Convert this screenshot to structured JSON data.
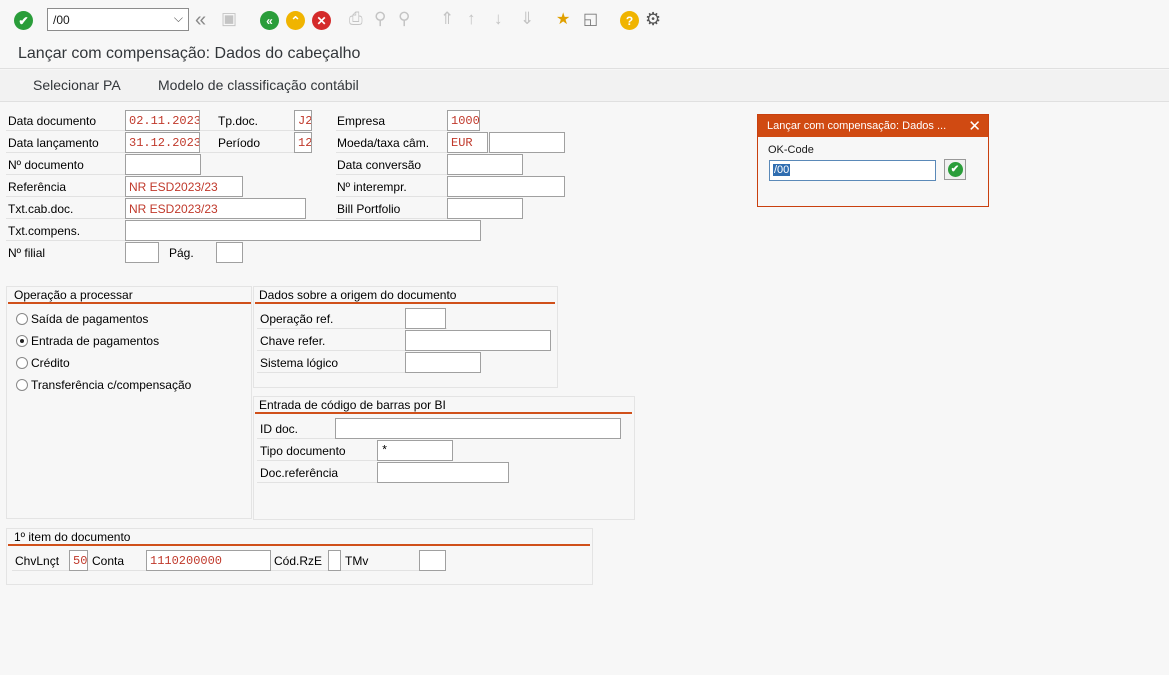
{
  "toolbar": {
    "command_value": "/00",
    "icons": [
      "enter-icon",
      "back-double-icon",
      "save-icon",
      "back-icon",
      "exit-icon",
      "cancel-icon",
      "print-icon",
      "find-icon",
      "find-next-icon",
      "first-page-icon",
      "previous-page-icon",
      "next-page-icon",
      "last-page-icon",
      "new-session-icon",
      "shortcut-icon",
      "help-icon",
      "settings-icon"
    ]
  },
  "header": {
    "title": "Lançar com compensação: Dados do cabeçalho"
  },
  "menu": {
    "item1": "Selecionar PA",
    "item2": "Modelo de classificação contábil"
  },
  "form": {
    "data_documento_label": "Data documento",
    "data_documento": "02.11.2023",
    "tp_doc_label": "Tp.doc.",
    "tp_doc": "J2",
    "empresa_label": "Empresa",
    "empresa": "1000",
    "data_lancamento_label": "Data lançamento",
    "data_lancamento": "31.12.2023",
    "periodo_label": "Período",
    "periodo": "12",
    "moeda_label": "Moeda/taxa câm.",
    "moeda": "EUR",
    "taxa": "",
    "no_documento_label": "Nº documento",
    "no_documento": "",
    "data_conversao_label": "Data conversão",
    "data_conversao": "",
    "referencia_label": "Referência",
    "referencia": "NR ESD2023/23",
    "no_interempr_label": "Nº interempr.",
    "no_interempr": "",
    "txt_cab_doc_label": "Txt.cab.doc.",
    "txt_cab_doc": "NR ESD2023/23",
    "bill_portfolio_label": "Bill Portfolio",
    "bill_portfolio": "",
    "txt_compens_label": "Txt.compens.",
    "txt_compens": "",
    "no_filial_label": "Nº filial",
    "no_filial": "",
    "pag_label": "Pág.",
    "pag": ""
  },
  "operacao": {
    "title": "Operação a processar",
    "options": [
      "Saída de pagamentos",
      "Entrada de pagamentos",
      "Crédito",
      "Transferência c/compensação"
    ],
    "selected": "Entrada de pagamentos"
  },
  "origem": {
    "title": "Dados sobre a origem do documento",
    "operacao_ref_label": "Operação ref.",
    "operacao_ref": "",
    "chave_refer_label": "Chave refer.",
    "chave_refer": "",
    "sistema_logico_label": "Sistema lógico",
    "sistema_logico": ""
  },
  "barras": {
    "title": "Entrada de código de barras por BI",
    "id_doc_label": "ID doc.",
    "id_doc": "",
    "tipo_documento_label": "Tipo documento",
    "tipo_documento": "*",
    "doc_referencia_label": "Doc.referência",
    "doc_referencia": ""
  },
  "item": {
    "title": "1º item do documento",
    "chvlnct_label": "ChvLnçt",
    "chvlnct": "50",
    "conta_label": "Conta",
    "conta": "1110200000",
    "cod_rze_label": "Cód.RzE",
    "cod_rze": "",
    "tmv_label": "TMv",
    "tmv": ""
  },
  "popup": {
    "title": "Lançar com compensação: Dados ...",
    "okcode_label": "OK-Code",
    "okcode_value": "/00"
  }
}
